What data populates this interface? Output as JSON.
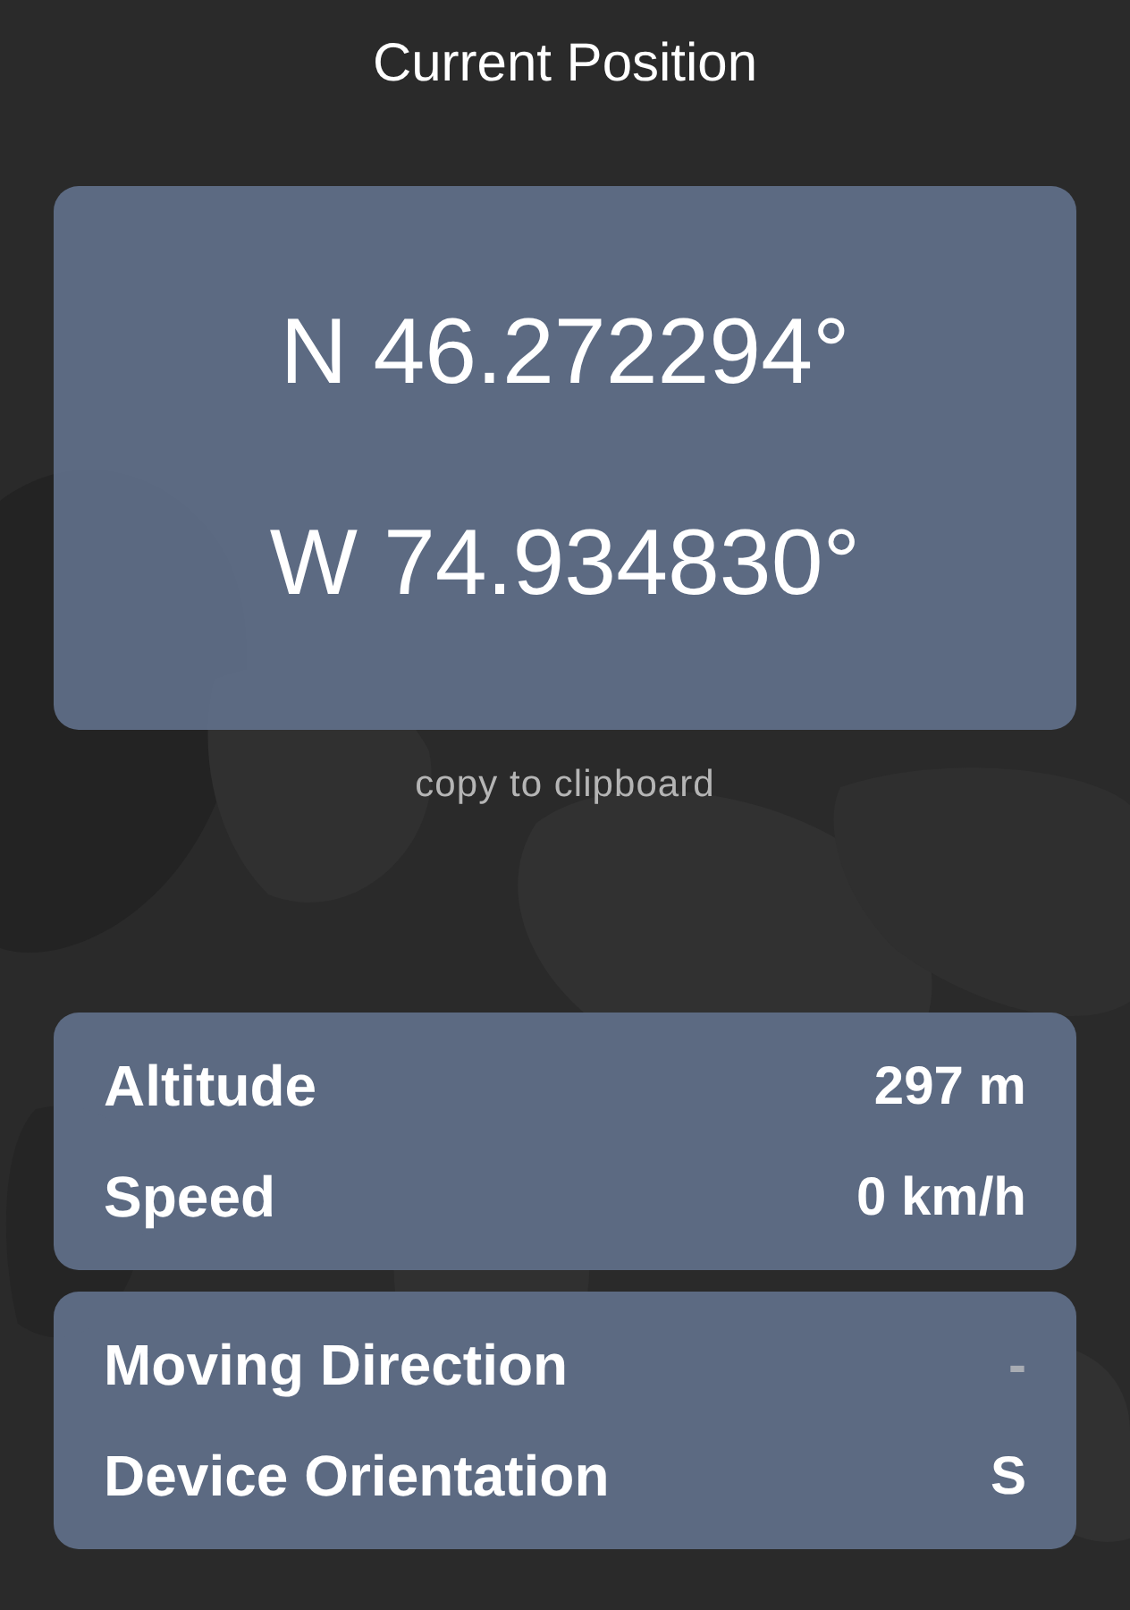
{
  "title": "Current Position",
  "coordinates": {
    "latitude": "N 46.272294°",
    "longitude": "W 74.934830°"
  },
  "copy_link": "copy to clipboard",
  "groups": [
    {
      "rows": [
        {
          "label": "Altitude",
          "value": "297 m",
          "unavailable": false
        },
        {
          "label": "Speed",
          "value": "0 km/h",
          "unavailable": false
        }
      ]
    },
    {
      "rows": [
        {
          "label": "Moving Direction",
          "value": "-",
          "unavailable": true
        },
        {
          "label": "Device Orientation",
          "value": "S",
          "unavailable": false
        }
      ]
    }
  ]
}
